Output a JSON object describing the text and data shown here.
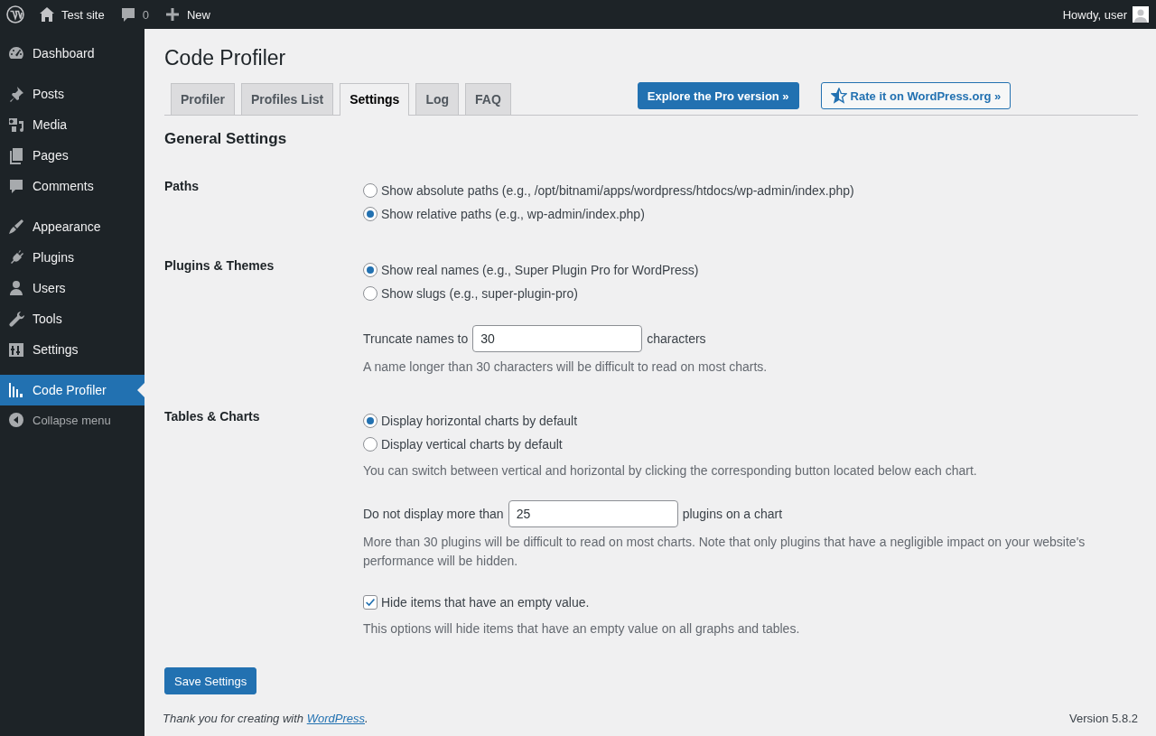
{
  "admin_bar": {
    "site": "Test site",
    "comments": "0",
    "new": "New",
    "greeting": "Howdy, user"
  },
  "sidebar": {
    "groups": [
      [
        {
          "label": "Dashboard",
          "selected": false
        }
      ],
      [
        {
          "label": "Posts",
          "selected": false
        },
        {
          "label": "Media",
          "selected": false
        },
        {
          "label": "Pages",
          "selected": false
        },
        {
          "label": "Comments",
          "selected": false
        }
      ],
      [
        {
          "label": "Appearance",
          "selected": false
        },
        {
          "label": "Plugins",
          "selected": false
        },
        {
          "label": "Users",
          "selected": false
        },
        {
          "label": "Tools",
          "selected": false
        },
        {
          "label": "Settings",
          "selected": false
        }
      ],
      [
        {
          "label": "Code Profiler",
          "selected": true
        }
      ]
    ],
    "collapse": "Collapse menu"
  },
  "page_title": "Code Profiler",
  "tabs": [
    {
      "label": "Profiler",
      "selected": false
    },
    {
      "label": "Profiles List",
      "selected": false
    },
    {
      "label": "Settings",
      "selected": true
    },
    {
      "label": "Log",
      "selected": false
    },
    {
      "label": "FAQ",
      "selected": false
    }
  ],
  "pro_button": "Explore the Pro version »",
  "rate_button": "Rate it on WordPress.org »",
  "section_title": "General Settings",
  "sections": [
    {
      "label": "Paths",
      "groups": [
        [
          {
            "kind": "radio",
            "label": "Show absolute paths (e.g., /opt/bitnami/apps/wordpress/htdocs/wp-admin/index.php)",
            "selected": false
          },
          {
            "kind": "radio",
            "label": "Show relative paths (e.g., wp-admin/index.php)",
            "selected": true
          }
        ]
      ]
    },
    {
      "label": "Plugins & Themes",
      "groups": [
        [
          {
            "kind": "radio",
            "label": "Show real names (e.g., Super Plugin Pro for WordPress)",
            "selected": true
          },
          {
            "kind": "radio",
            "label": "Show slugs (e.g., super-plugin-pro)",
            "selected": false
          }
        ],
        [
          {
            "kind": "number",
            "prefix": "Truncate names to",
            "value": "30",
            "suffix": "characters"
          },
          {
            "kind": "description",
            "text": "A name longer than 30 characters will be difficult to read on most charts."
          }
        ]
      ]
    },
    {
      "label": "Tables & Charts",
      "groups": [
        [
          {
            "kind": "radio",
            "label": "Display horizontal charts by default",
            "selected": true
          },
          {
            "kind": "radio",
            "label": "Display vertical charts by default",
            "selected": false
          },
          {
            "kind": "description",
            "text": "You can switch between vertical and horizontal by clicking the corresponding button located below each chart."
          }
        ],
        [
          {
            "kind": "number",
            "prefix": "Do not display more than",
            "value": "25",
            "suffix": "plugins on a chart"
          },
          {
            "kind": "description",
            "text": "More than 30 plugins will be difficult to read on most charts. Note that only plugins that have a negligible impact on your website's performance will be hidden."
          }
        ],
        [
          {
            "kind": "checkbox",
            "label": "Hide items that have an empty value.",
            "checked": true
          },
          {
            "kind": "description",
            "text": "This options will hide items that have an empty value on all graphs and tables."
          }
        ]
      ]
    }
  ],
  "save_button": "Save Settings",
  "footer": {
    "prefix": "Thank you for creating with ",
    "link": "WordPress",
    "suffix": ".",
    "version": "Version 5.8.2"
  }
}
